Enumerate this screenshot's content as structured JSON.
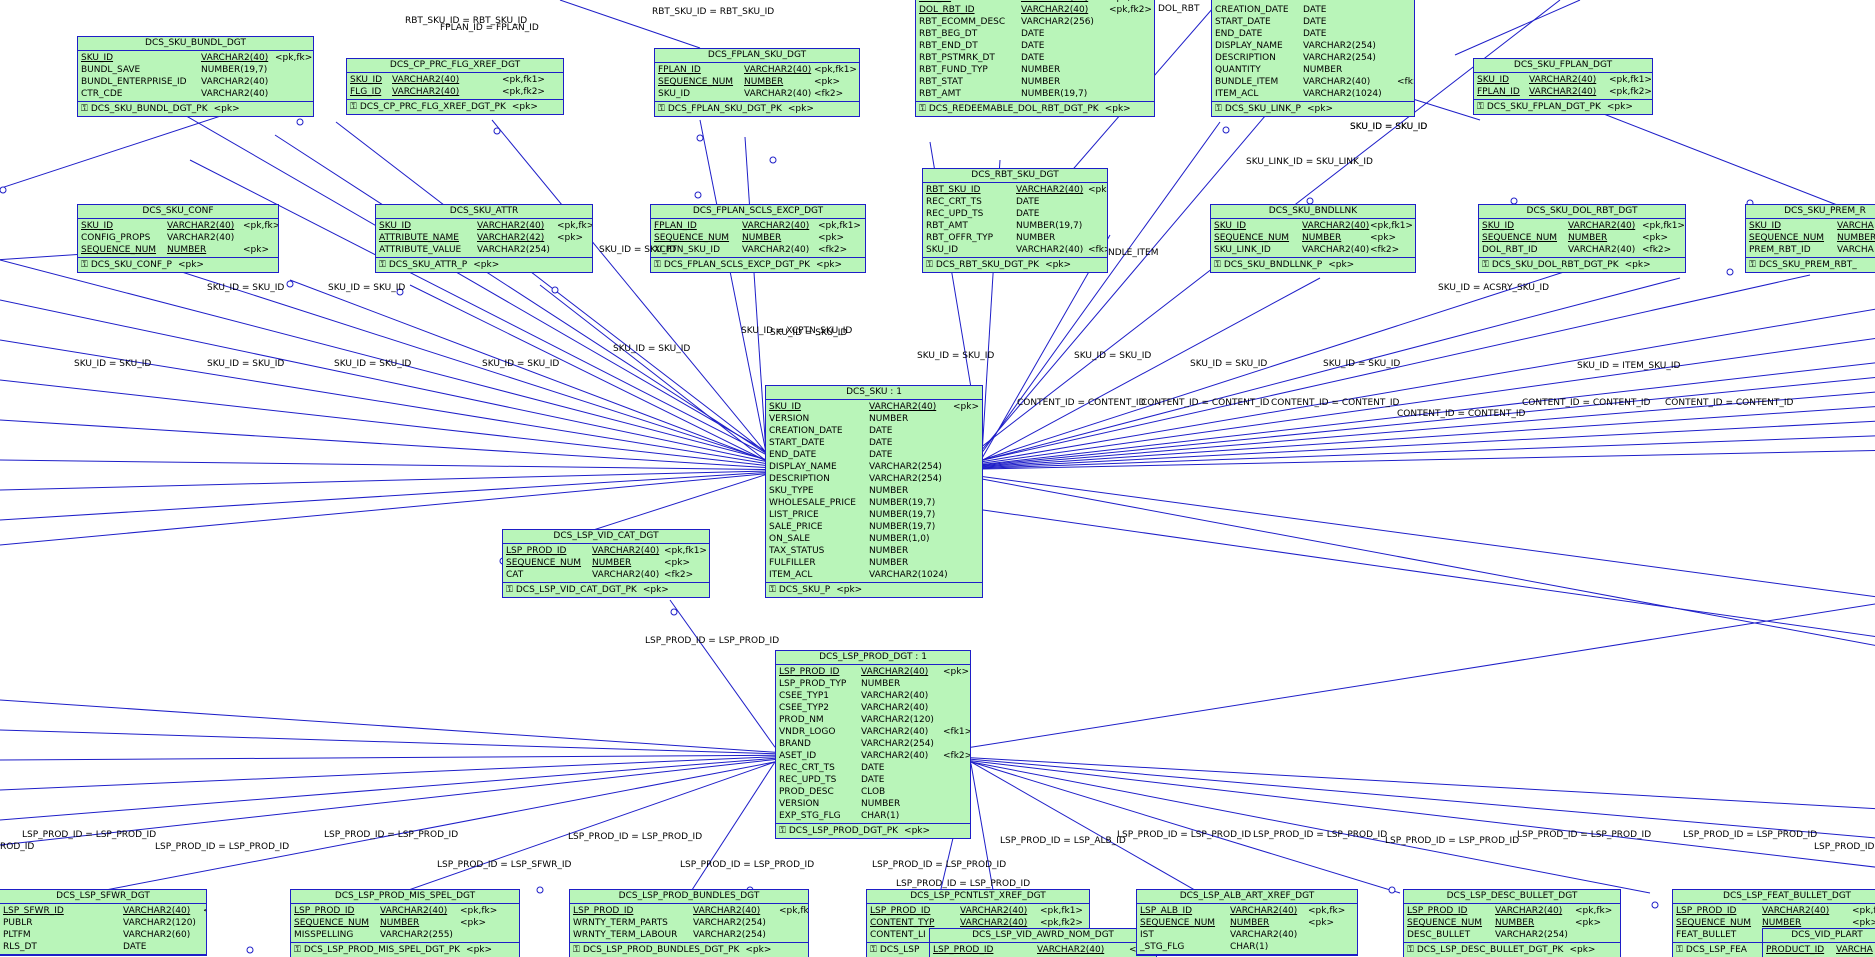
{
  "entities": [
    {
      "id": "dcs_sku_bundl_dgt",
      "title": "DCS_SKU_BUNDL_DGT",
      "pk": "DCS_SKU_BUNDL_DGT_PK",
      "pk_tag": "<pk>",
      "columns": [
        [
          "SKU_ID",
          "VARCHAR2(40)",
          "<pk,fk>",
          1
        ],
        [
          "BUNDL_SAVE",
          "NUMBER(19,7)",
          "",
          0
        ],
        [
          "BUNDL_ENTERPRISE_ID",
          "VARCHAR2(40)",
          "",
          0
        ],
        [
          "CTR_CDE",
          "VARCHAR2(40)",
          "",
          0
        ]
      ]
    },
    {
      "id": "dcs_cp_prc_flg_xref_dgt",
      "title": "DCS_CP_PRC_FLG_XREF_DGT",
      "pk": "DCS_CP_PRC_FLG_XREF_DGT_PK",
      "pk_tag": "<pk>",
      "columns": [
        [
          "SKU_ID",
          "VARCHAR2(40)",
          "<pk,fk1>",
          1
        ],
        [
          "FLG_ID",
          "VARCHAR2(40)",
          "<pk,fk2>",
          1
        ]
      ]
    },
    {
      "id": "dcs_fplan_sku_dgt",
      "title": "DCS_FPLAN_SKU_DGT",
      "pk": "DCS_FPLAN_SKU_DGT_PK",
      "pk_tag": "<pk>",
      "columns": [
        [
          "FPLAN_ID",
          "VARCHAR2(40)",
          "<pk,fk1>",
          1
        ],
        [
          "SEQUENCE_NUM",
          "NUMBER",
          "<pk>",
          1
        ],
        [
          "SKU_ID",
          "VARCHAR2(40)",
          "<fk2>",
          0
        ]
      ]
    },
    {
      "id": "dcs_redeemable_dol_rbt_dgt",
      "title": "",
      "pk": "DCS_REDEEMABLE_DOL_RBT_DGT_PK",
      "pk_tag": "<pk>",
      "columns": [
        [
          "SKU_ID",
          "VARCHAR2(40)",
          "<pk,fk>",
          1
        ],
        [
          "DOL_RBT_ID",
          "VARCHAR2(40)",
          "<pk,fk2>",
          1
        ],
        [
          "RBT_ECOMM_DESC",
          "VARCHAR2(256)",
          "",
          0
        ],
        [
          "RBT_BEG_DT",
          "DATE",
          "",
          0
        ],
        [
          "RBT_END_DT",
          "DATE",
          "",
          0
        ],
        [
          "RBT_PSTMRK_DT",
          "DATE",
          "",
          0
        ],
        [
          "RBT_FUND_TYP",
          "NUMBER",
          "",
          0
        ],
        [
          "RBT_STAT",
          "NUMBER",
          "",
          0
        ],
        [
          "RBT_AMT",
          "NUMBER(19,7)",
          "",
          0
        ]
      ]
    },
    {
      "id": "dcs_sku_link",
      "title": "",
      "pk": "DCS_SKU_LINK_P",
      "pk_tag": "<pk>",
      "columns": [
        [
          "VERSION",
          "NUMBER",
          "",
          0
        ],
        [
          "CREATION_DATE",
          "DATE",
          "",
          0
        ],
        [
          "START_DATE",
          "DATE",
          "",
          0
        ],
        [
          "END_DATE",
          "DATE",
          "",
          0
        ],
        [
          "DISPLAY_NAME",
          "VARCHAR2(254)",
          "",
          0
        ],
        [
          "DESCRIPTION",
          "VARCHAR2(254)",
          "",
          0
        ],
        [
          "QUANTITY",
          "NUMBER",
          "",
          0
        ],
        [
          "BUNDLE_ITEM",
          "VARCHAR2(40)",
          "<fk>",
          0
        ],
        [
          "ITEM_ACL",
          "VARCHAR2(1024)",
          "",
          0
        ]
      ]
    },
    {
      "id": "dcs_sku_fplan_dgt",
      "title": "DCS_SKU_FPLAN_DGT",
      "pk": "DCS_SKU_FPLAN_DGT_PK",
      "pk_tag": "<pk>",
      "columns": [
        [
          "SKU_ID",
          "VARCHAR2(40)",
          "<pk,fk1>",
          1
        ],
        [
          "FPLAN_ID",
          "VARCHAR2(40)",
          "<pk,fk2>",
          1
        ]
      ]
    },
    {
      "id": "dcs_sku_conf",
      "title": "DCS_SKU_CONF",
      "pk": "DCS_SKU_CONF_P",
      "pk_tag": "<pk>",
      "columns": [
        [
          "SKU_ID",
          "VARCHAR2(40)",
          "<pk,fk>",
          1
        ],
        [
          "CONFIG_PROPS",
          "VARCHAR2(40)",
          "",
          0
        ],
        [
          "SEQUENCE_NUM",
          "NUMBER",
          "<pk>",
          1
        ]
      ]
    },
    {
      "id": "dcs_sku_attr",
      "title": "DCS_SKU_ATTR",
      "pk": "DCS_SKU_ATTR_P",
      "pk_tag": "<pk>",
      "columns": [
        [
          "SKU_ID",
          "VARCHAR2(40)",
          "<pk,fk>",
          1
        ],
        [
          "ATTRIBUTE_NAME",
          "VARCHAR2(42)",
          "<pk>",
          1
        ],
        [
          "ATTRIBUTE_VALUE",
          "VARCHAR2(254)",
          "",
          0
        ]
      ]
    },
    {
      "id": "dcs_fplan_scls_excp_dgt",
      "title": "DCS_FPLAN_SCLS_EXCP_DGT",
      "pk": "DCS_FPLAN_SCLS_EXCP_DGT_PK",
      "pk_tag": "<pk>",
      "columns": [
        [
          "FPLAN_ID",
          "VARCHAR2(40)",
          "<pk,fk1>",
          1
        ],
        [
          "SEQUENCE_NUM",
          "NUMBER",
          "<pk>",
          1
        ],
        [
          "XCPTN_SKU_ID",
          "VARCHAR2(40)",
          "<fk2>",
          0
        ]
      ]
    },
    {
      "id": "dcs_rbt_sku_dgt",
      "title": "DCS_RBT_SKU_DGT",
      "pk": "DCS_RBT_SKU_DGT_PK",
      "pk_tag": "<pk>",
      "columns": [
        [
          "RBT_SKU_ID",
          "VARCHAR2(40)",
          "<pk>",
          1
        ],
        [
          "REC_CRT_TS",
          "DATE",
          "",
          0
        ],
        [
          "REC_UPD_TS",
          "DATE",
          "",
          0
        ],
        [
          "RBT_AMT",
          "NUMBER(19,7)",
          "",
          0
        ],
        [
          "RBT_OFFR_TYP",
          "NUMBER",
          "",
          0
        ],
        [
          "SKU_ID",
          "VARCHAR2(40)",
          "<fk>",
          0
        ]
      ]
    },
    {
      "id": "dcs_sku_bndllnk",
      "title": "DCS_SKU_BNDLLNK",
      "pk": "DCS_SKU_BNDLLNK_P",
      "pk_tag": "<pk>",
      "columns": [
        [
          "SKU_ID",
          "VARCHAR2(40)",
          "<pk,fk1>",
          1
        ],
        [
          "SEQUENCE_NUM",
          "NUMBER",
          "<pk>",
          1
        ],
        [
          "SKU_LINK_ID",
          "VARCHAR2(40)",
          "<fk2>",
          0
        ]
      ]
    },
    {
      "id": "dcs_sku_dol_rbt_dgt",
      "title": "DCS_SKU_DOL_RBT_DGT",
      "pk": "DCS_SKU_DOL_RBT_DGT_PK",
      "pk_tag": "<pk>",
      "columns": [
        [
          "SKU_ID",
          "VARCHAR2(40)",
          "<pk,fk1>",
          1
        ],
        [
          "SEQUENCE_NUM",
          "NUMBER",
          "<pk>",
          1
        ],
        [
          "DOL_RBT_ID",
          "VARCHAR2(40)",
          "<fk2>",
          0
        ]
      ]
    },
    {
      "id": "dcs_sku_prem_rbt",
      "title": "DCS_SKU_PREM_R",
      "pk": "DCS_SKU_PREM_RBT_",
      "pk_tag": "",
      "columns": [
        [
          "SKU_ID",
          "VARCHA",
          "",
          1
        ],
        [
          "SEQUENCE_NUM",
          "NUMBER",
          "",
          1
        ],
        [
          "PREM_RBT_ID",
          "VARCHA",
          "",
          0
        ]
      ]
    },
    {
      "id": "dcs_sku",
      "title": "DCS_SKU : 1",
      "pk": "DCS_SKU_P",
      "pk_tag": "<pk>",
      "columns": [
        [
          "SKU_ID",
          "VARCHAR2(40)",
          "<pk>",
          1
        ],
        [
          "VERSION",
          "NUMBER",
          "",
          0
        ],
        [
          "CREATION_DATE",
          "DATE",
          "",
          0
        ],
        [
          "START_DATE",
          "DATE",
          "",
          0
        ],
        [
          "END_DATE",
          "DATE",
          "",
          0
        ],
        [
          "DISPLAY_NAME",
          "VARCHAR2(254)",
          "",
          0
        ],
        [
          "DESCRIPTION",
          "VARCHAR2(254)",
          "",
          0
        ],
        [
          "SKU_TYPE",
          "NUMBER",
          "",
          0
        ],
        [
          "WHOLESALE_PRICE",
          "NUMBER(19,7)",
          "",
          0
        ],
        [
          "LIST_PRICE",
          "NUMBER(19,7)",
          "",
          0
        ],
        [
          "SALE_PRICE",
          "NUMBER(19,7)",
          "",
          0
        ],
        [
          "ON_SALE",
          "NUMBER(1,0)",
          "",
          0
        ],
        [
          "TAX_STATUS",
          "NUMBER",
          "",
          0
        ],
        [
          "FULFILLER",
          "NUMBER",
          "",
          0
        ],
        [
          "ITEM_ACL",
          "VARCHAR2(1024)",
          "",
          0
        ]
      ]
    },
    {
      "id": "dcs_lsp_vid_cat_dgt",
      "title": "DCS_LSP_VID_CAT_DGT",
      "pk": "DCS_LSP_VID_CAT_DGT_PK",
      "pk_tag": "<pk>",
      "columns": [
        [
          "LSP_PROD_ID",
          "VARCHAR2(40)",
          "<pk,fk1>",
          1
        ],
        [
          "SEQUENCE_NUM",
          "NUMBER",
          "<pk>",
          1
        ],
        [
          "CAT",
          "VARCHAR2(40)",
          "<fk2>",
          0
        ]
      ]
    },
    {
      "id": "dcs_lsp_prod_dgt",
      "title": "DCS_LSP_PROD_DGT : 1",
      "pk": "DCS_LSP_PROD_DGT_PK",
      "pk_tag": "<pk>",
      "columns": [
        [
          "LSP_PROD_ID",
          "VARCHAR2(40)",
          "<pk>",
          1
        ],
        [
          "LSP_PROD_TYP",
          "NUMBER",
          "",
          0
        ],
        [
          "CSEE_TYP1",
          "VARCHAR2(40)",
          "",
          0
        ],
        [
          "CSEE_TYP2",
          "VARCHAR2(40)",
          "",
          0
        ],
        [
          "PROD_NM",
          "VARCHAR2(120)",
          "",
          0
        ],
        [
          "VNDR_LOGO",
          "VARCHAR2(40)",
          "<fk1>",
          0
        ],
        [
          "BRAND",
          "VARCHAR2(254)",
          "",
          0
        ],
        [
          "ASET_ID",
          "VARCHAR2(40)",
          "<fk2>",
          0
        ],
        [
          "REC_CRT_TS",
          "DATE",
          "",
          0
        ],
        [
          "REC_UPD_TS",
          "DATE",
          "",
          0
        ],
        [
          "PROD_DESC",
          "CLOB",
          "",
          0
        ],
        [
          "VERSION",
          "NUMBER",
          "",
          0
        ],
        [
          "EXP_STG_FLG",
          "CHAR(1)",
          "",
          0
        ]
      ]
    },
    {
      "id": "dcs_lsp_sfwr_dgt",
      "title": "DCS_LSP_SFWR_DGT",
      "pk": "",
      "pk_tag": "",
      "columns": [
        [
          "LSP_SFWR_ID",
          "VARCHAR2(40)",
          "<pk,fk>",
          1
        ],
        [
          "PUBLR",
          "VARCHAR2(120)",
          "",
          0
        ],
        [
          "PLTFM",
          "VARCHAR2(60)",
          "",
          0
        ],
        [
          "RLS_DT",
          "DATE",
          "",
          0
        ]
      ]
    },
    {
      "id": "dcs_lsp_prod_mis_spel_dgt",
      "title": "DCS_LSP_PROD_MIS_SPEL_DGT",
      "pk": "DCS_LSP_PROD_MIS_SPEL_DGT_PK",
      "pk_tag": "<pk>",
      "columns": [
        [
          "LSP_PROD_ID",
          "VARCHAR2(40)",
          "<pk,fk>",
          1
        ],
        [
          "SEQUENCE_NUM",
          "NUMBER",
          "<pk>",
          1
        ],
        [
          "MISSPELLING",
          "VARCHAR2(255)",
          "",
          0
        ]
      ]
    },
    {
      "id": "dcs_lsp_prod_bundles_dgt",
      "title": "DCS_LSP_PROD_BUNDLES_DGT",
      "pk": "DCS_LSP_PROD_BUNDLES_DGT_PK",
      "pk_tag": "<pk>",
      "columns": [
        [
          "LSP_PROD_ID",
          "VARCHAR2(40)",
          "<pk,fk>",
          1
        ],
        [
          "WRNTY_TERM_PARTS",
          "VARCHAR2(254)",
          "",
          0
        ],
        [
          "WRNTY_TERM_LABOUR",
          "VARCHAR2(254)",
          "",
          0
        ]
      ]
    },
    {
      "id": "dcs_lsp_pcntlst_xref_dgt",
      "title": "DCS_LSP_PCNTLST_XREF_DGT",
      "pk": "DCS_LSP",
      "pk_tag": "",
      "columns": [
        [
          "LSP_PROD_ID",
          "VARCHAR2(40)",
          "<pk,fk1>",
          1
        ],
        [
          "CONTENT_TYP",
          "VARCHAR2(40)",
          "<pk,fk2>",
          1
        ],
        [
          "CONTENT_LI",
          "",
          "",
          0
        ]
      ]
    },
    {
      "id": "dcs_lsp_vid_awrd_nom_dgt",
      "title": "DCS_LSP_VID_AWRD_NOM_DGT",
      "pk": "",
      "pk_tag": "",
      "columns": [
        [
          "LSP_PROD_ID",
          "VARCHAR2(40)",
          "<pk,fk1>",
          1
        ]
      ]
    },
    {
      "id": "dcs_lsp_alb_art_xref_dgt",
      "title": "DCS_LSP_ALB_ART_XREF_DGT",
      "pk": "",
      "pk_tag": "",
      "columns": [
        [
          "LSP_ALB_ID",
          "VARCHAR2(40)",
          "<pk,fk>",
          1
        ],
        [
          "SEQUENCE_NUM",
          "NUMBER",
          "<pk>",
          1
        ],
        [
          "IST",
          "VARCHAR2(40)",
          "",
          0
        ],
        [
          "_STG_FLG",
          "CHAR(1)",
          "",
          0
        ]
      ]
    },
    {
      "id": "dcs_lsp_desc_bullet_dgt",
      "title": "DCS_LSP_DESC_BULLET_DGT",
      "pk": "DCS_LSP_DESC_BULLET_DGT_PK",
      "pk_tag": "<pk>",
      "columns": [
        [
          "LSP_PROD_ID",
          "VARCHAR2(40)",
          "<pk,fk>",
          1
        ],
        [
          "SEQUENCE_NUM",
          "NUMBER",
          "<pk>",
          1
        ],
        [
          "DESC_BULLET",
          "VARCHAR2(254)",
          "",
          0
        ]
      ]
    },
    {
      "id": "dcs_lsp_feat_bullet_dgt",
      "title": "DCS_LSP_FEAT_BULLET_DGT",
      "pk": "DCS_LSP_FEA",
      "pk_tag": "",
      "columns": [
        [
          "LSP_PROD_ID",
          "VARCHAR2(40)",
          "<pk,fk>",
          1
        ],
        [
          "SEQUENCE_NUM",
          "NUMBER",
          "<pk>",
          1
        ],
        [
          "FEAT_BULLET",
          "",
          "",
          0
        ]
      ]
    },
    {
      "id": "dcs_vid_plart",
      "title": "DCS_VID_PLART",
      "pk": "",
      "pk_tag": "",
      "columns": [
        [
          "PRODUCT_ID",
          "VARCHA",
          "",
          1
        ]
      ]
    }
  ],
  "relations": [
    "RBT_SKU_ID = RBT_SKU_ID",
    "FPLAN_ID = FPLAN_ID",
    "RBT_SKU_ID = RBT_SKU_ID",
    "DOL_RBT",
    "SKU_ID = SKU_ID",
    "SKU_LINK_ID = SKU_LINK_ID",
    "SKU_ID = SKU_ID",
    "SKU_ID = SKU_ID",
    "NDLE_ITEM",
    "SKU_ID = SKU_ID",
    "SKU_ID = SKU_ID",
    "SKU_ID = ACSRY_SKU_ID",
    "SKU_ID = XCPTN_SKU_ID",
    "SKU_ID = SKU_ID",
    "SKU_ID = SKU_ID",
    "SKU_ID = SKU_ID",
    "SKU_ID = SKU_ID",
    "SKU_ID = SKU_ID",
    "SKU_ID = SKU_ID",
    "SKU_ID = SKU_ID",
    "SKU_ID = SKU_ID",
    "SKU_ID = SKU_ID",
    "SKU_ID = SKU_ID",
    "SKU_ID = ITEM_SKU_ID",
    "CONTENT_ID = CONTENT_ID",
    "CONTENT_ID = CONTENT_ID",
    "CONTENT_ID = CONTENT_ID",
    "CONTENT_ID = CONTENT_ID",
    "CONTENT_ID = CONTENT_ID",
    "CONTENT_ID = CONTENT_ID",
    "LSP_PROD_ID = LSP_PROD_ID",
    "LSP_PROD_ID = LSP_PROD_ID",
    "LSP_PROD_ID = LSP_PROD_ID",
    "LSP_PROD_ID = LSP_PROD_ID",
    "LSP_PROD_ID = LSP_PROD_ID",
    "LSP_PROD_ID = LSP_SFWR_ID",
    "LSP_PROD_ID = LSP_PROD_ID",
    "LSP_PROD_ID = LSP_PROD_ID",
    "LSP_PROD_ID = LSP_PROD_ID",
    "LSP_PROD_ID = LSP_ALB_ID",
    "LSP_PROD_ID = LSP_PROD_ID",
    "LSP_PROD_ID = LSP_PROD_ID",
    "LSP_PROD_ID = LSP_PROD_ID",
    "LSP_PROD_ID = LSP_PROD_ID",
    "LSP_PROD_ID = LSP_PROD_ID",
    "ROD_ID",
    "LSP_PROD_ID = LSP_PROD_ID"
  ],
  "colors": {
    "entity_fill": "#b9f5b9",
    "line": "#1e1ec8"
  }
}
